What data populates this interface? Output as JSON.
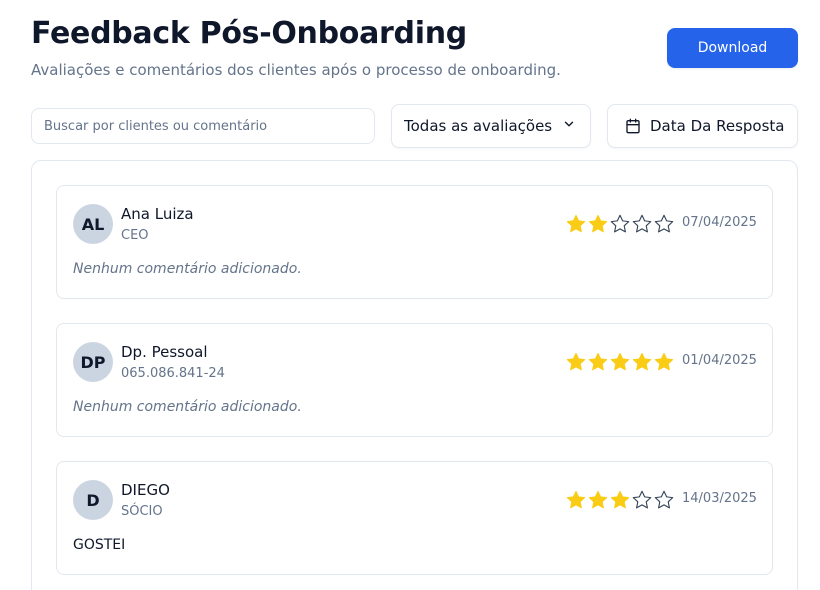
{
  "header": {
    "title": "Feedback Pós-Onboarding",
    "subtitle": "Avaliações e comentários dos clientes após o processo de onboarding.",
    "download_label": "Download"
  },
  "filters": {
    "search_placeholder": "Buscar por clientes ou comentário",
    "search_value": "",
    "rating_selected": "Todas as avaliações",
    "date_label": "Data Da Resposta"
  },
  "colors": {
    "accent": "#2563eb",
    "star_filled": "#facc15",
    "star_empty_outline": "#334155"
  },
  "feedbacks": [
    {
      "initials": "AL",
      "name": "Ana Luiza",
      "role": "CEO",
      "rating": 2,
      "max_rating": 5,
      "date": "07/04/2025",
      "comment": "Nenhum comentário adicionado.",
      "comment_empty": true
    },
    {
      "initials": "DP",
      "name": "Dp. Pessoal",
      "role": "065.086.841-24",
      "rating": 5,
      "max_rating": 5,
      "date": "01/04/2025",
      "comment": "Nenhum comentário adicionado.",
      "comment_empty": true
    },
    {
      "initials": "D",
      "name": "DIEGO",
      "role": "SÓCIO",
      "rating": 3,
      "max_rating": 5,
      "date": "14/03/2025",
      "comment": "GOSTEI",
      "comment_empty": false
    }
  ],
  "icons": {
    "dropdown": "chevron-down-icon",
    "date": "calendar-icon",
    "rating": "star-icon"
  }
}
